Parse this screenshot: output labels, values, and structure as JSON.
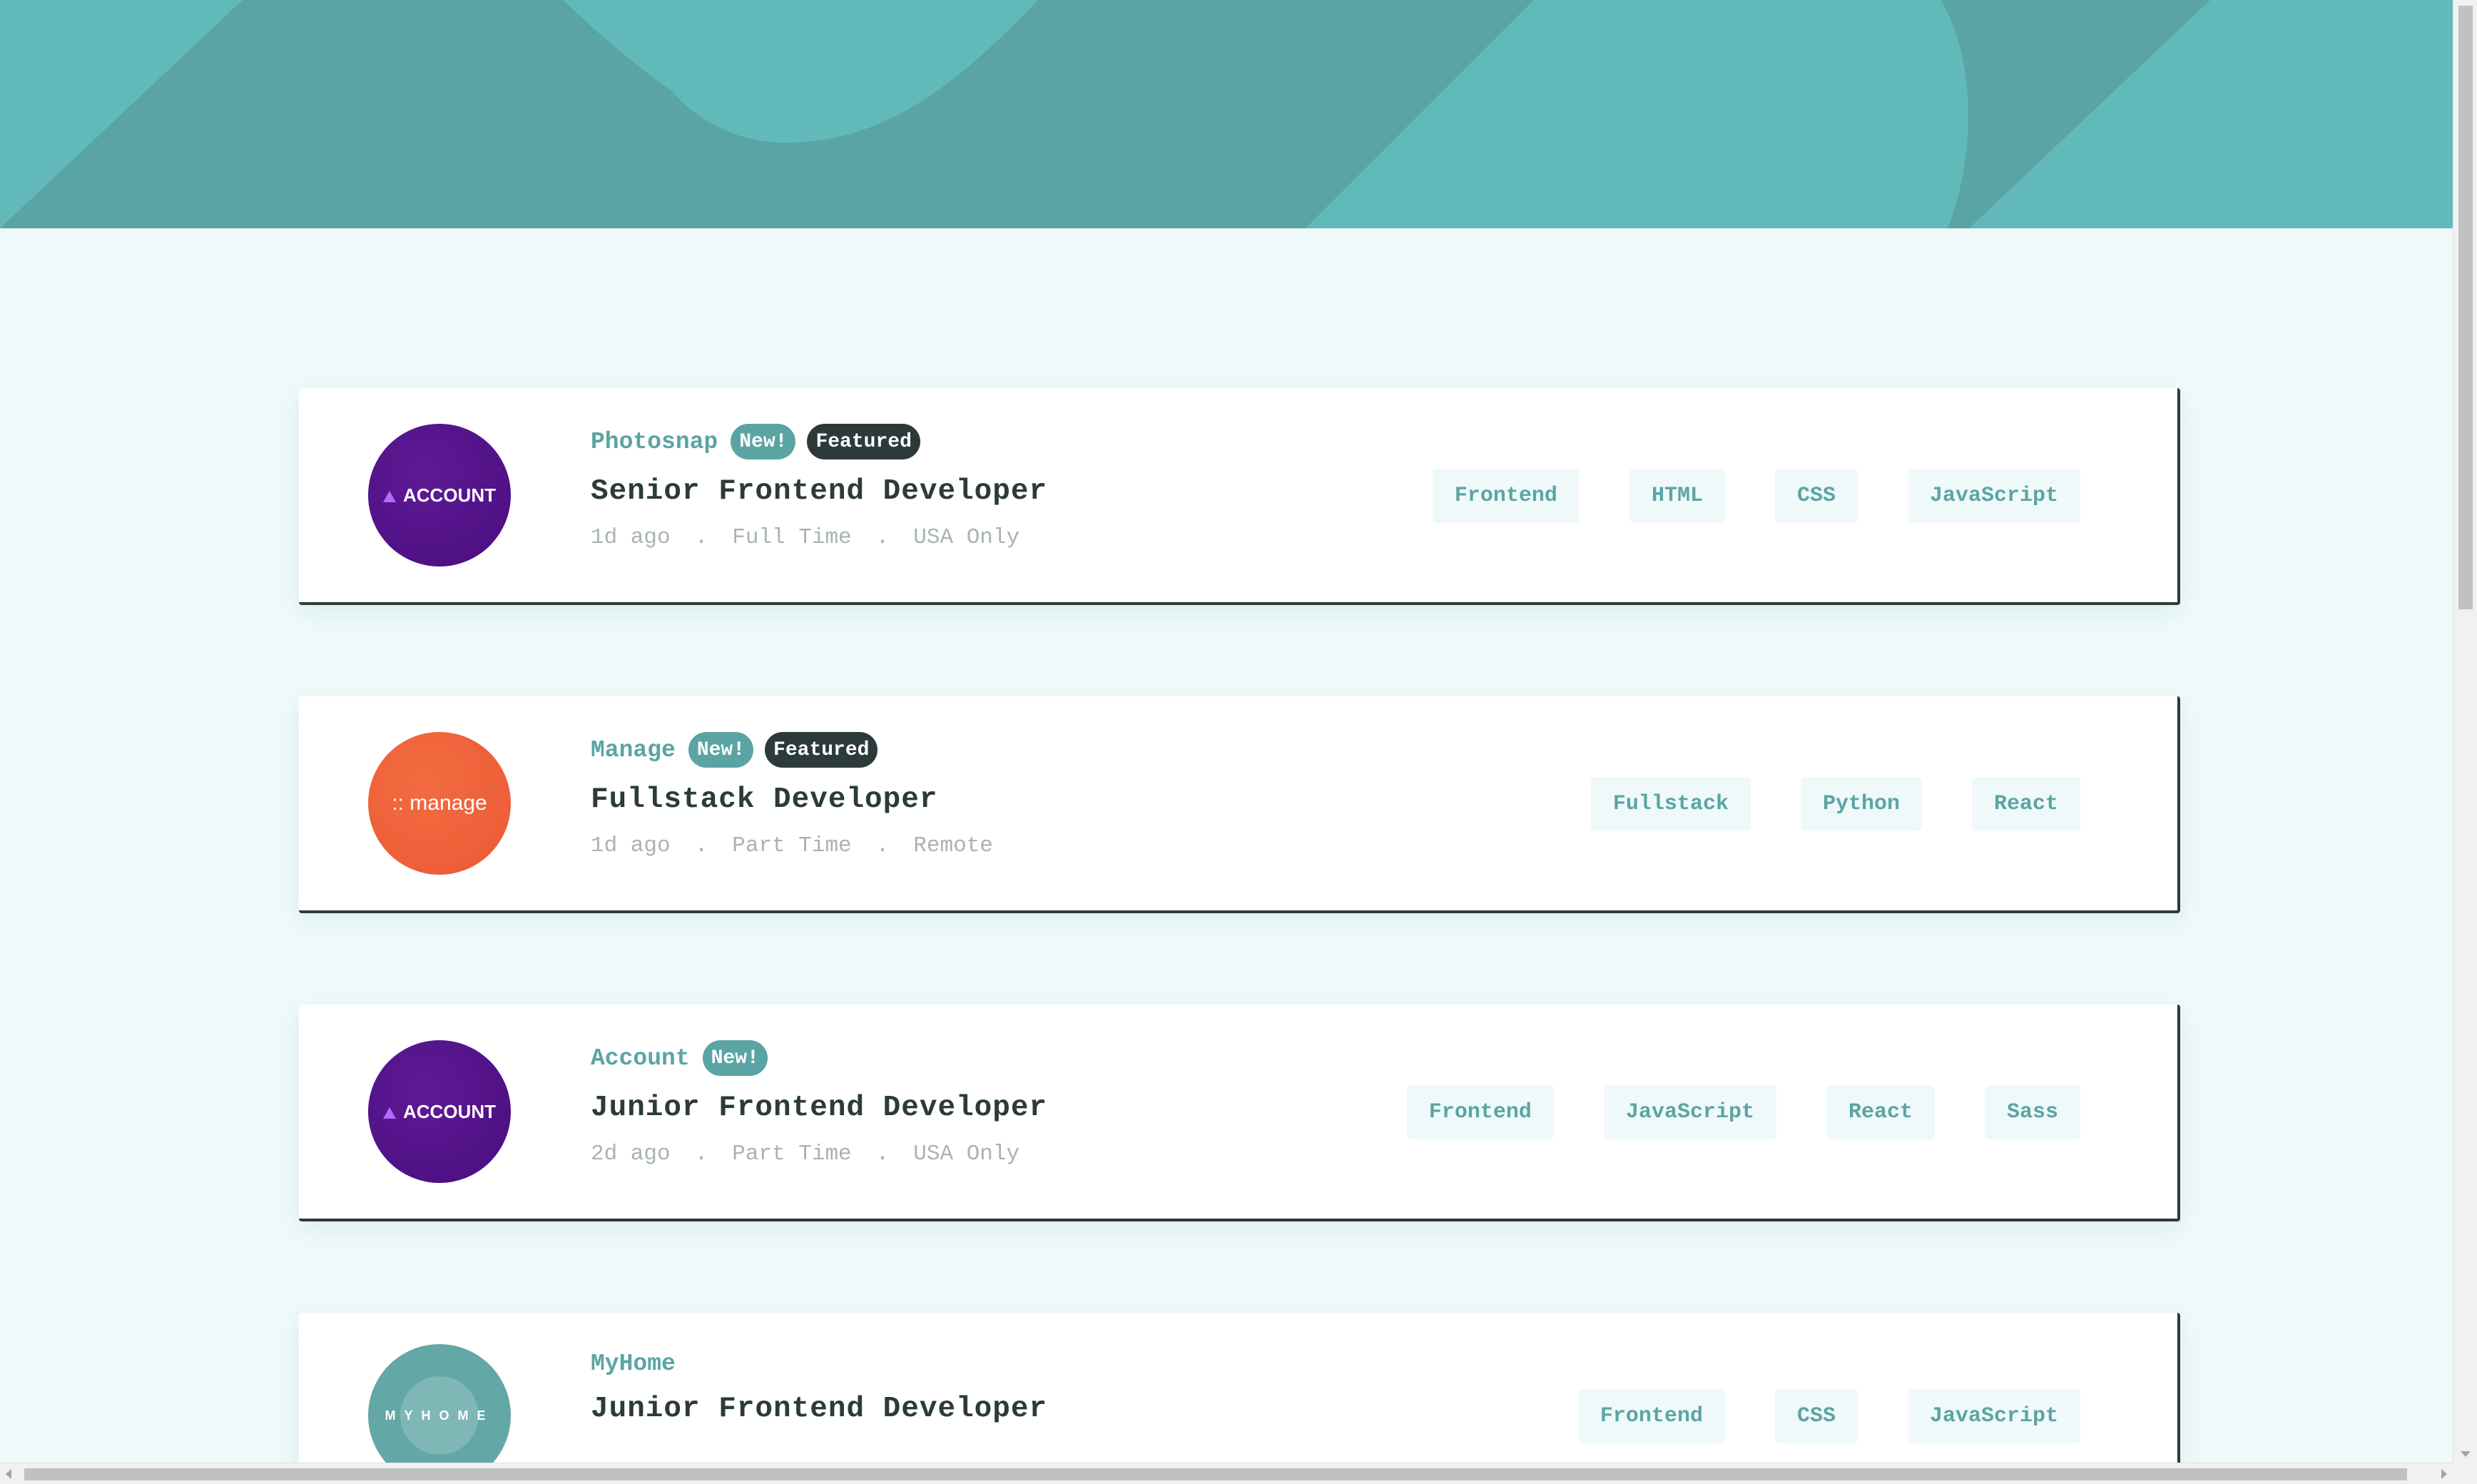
{
  "colors": {
    "primary": "#5ba4a4",
    "dark": "#2c3a3a",
    "background": "#eff9f9",
    "banner": "#62b9ba",
    "muted": "#a9b3b3"
  },
  "jobs": [
    {
      "company": "Photosnap",
      "logo": {
        "icon": "account-logo",
        "text": "ACCOUNT",
        "color": "#4a0d7e"
      },
      "badges": {
        "new": "New!",
        "featured": "Featured"
      },
      "position": "Senior Frontend Developer",
      "posted": "1d ago",
      "contract": "Full Time",
      "location": "USA Only",
      "tags": [
        "Frontend",
        "HTML",
        "CSS",
        "JavaScript"
      ]
    },
    {
      "company": "Manage",
      "logo": {
        "icon": "manage-logo",
        "text": ":: manage",
        "color": "#eb5a35"
      },
      "badges": {
        "new": "New!",
        "featured": "Featured"
      },
      "position": "Fullstack Developer",
      "posted": "1d ago",
      "contract": "Part Time",
      "location": "Remote",
      "tags": [
        "Fullstack",
        "Python",
        "React"
      ]
    },
    {
      "company": "Account",
      "logo": {
        "icon": "account-logo",
        "text": "ACCOUNT",
        "color": "#4a0d7e"
      },
      "badges": {
        "new": "New!"
      },
      "position": "Junior Frontend Developer",
      "posted": "2d ago",
      "contract": "Part Time",
      "location": "USA Only",
      "tags": [
        "Frontend",
        "JavaScript",
        "React",
        "Sass"
      ]
    },
    {
      "company": "MyHome",
      "logo": {
        "icon": "myhome-logo",
        "text": "MYHOME",
        "color": "#63a7a6"
      },
      "badges": {},
      "position": "Junior Frontend Developer",
      "tags": [
        "Frontend",
        "CSS",
        "JavaScript"
      ]
    }
  ],
  "separator": "."
}
